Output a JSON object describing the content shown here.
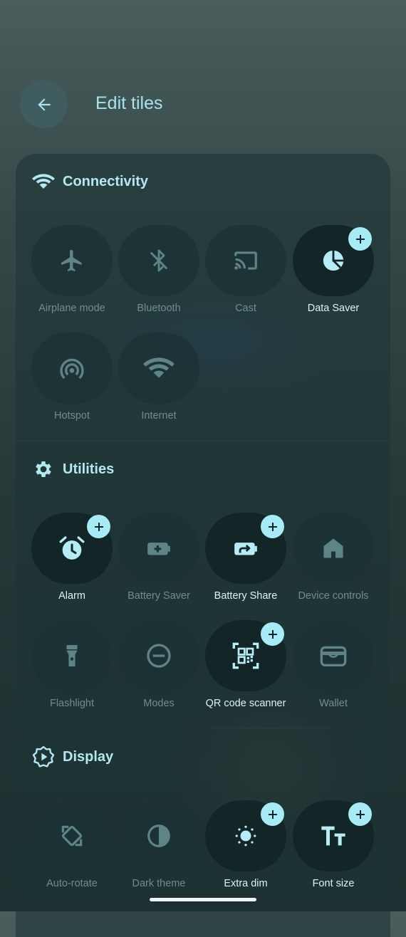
{
  "header": {
    "title": "Edit tiles"
  },
  "sections": [
    {
      "title": "Connectivity",
      "tiles": [
        {
          "label": "Airplane mode",
          "icon": "airplane-icon",
          "active": false
        },
        {
          "label": "Bluetooth",
          "icon": "bluetooth-off-icon",
          "active": false
        },
        {
          "label": "Cast",
          "icon": "cast-icon",
          "active": false
        },
        {
          "label": "Data Saver",
          "icon": "data-saver-icon",
          "active": true
        },
        {
          "label": "Hotspot",
          "icon": "hotspot-icon",
          "active": false
        },
        {
          "label": "Internet",
          "icon": "wifi-icon",
          "active": false
        }
      ]
    },
    {
      "title": "Utilities",
      "tiles": [
        {
          "label": "Alarm",
          "icon": "alarm-icon",
          "active": true
        },
        {
          "label": "Battery Saver",
          "icon": "battery-saver-icon",
          "active": false
        },
        {
          "label": "Battery Share",
          "icon": "battery-share-icon",
          "active": true
        },
        {
          "label": "Device controls",
          "icon": "home-icon",
          "active": false
        },
        {
          "label": "Flashlight",
          "icon": "flashlight-icon",
          "active": false
        },
        {
          "label": "Modes",
          "icon": "modes-icon",
          "active": false
        },
        {
          "label": "QR code scanner",
          "icon": "qr-scanner-icon",
          "active": true
        },
        {
          "label": "Wallet",
          "icon": "wallet-icon",
          "active": false
        }
      ]
    },
    {
      "title": "Display",
      "tiles": [
        {
          "label": "Auto-rotate",
          "icon": "auto-rotate-icon",
          "active": false
        },
        {
          "label": "Dark theme",
          "icon": "dark-theme-icon",
          "active": false
        },
        {
          "label": "Extra dim",
          "icon": "extra-dim-icon",
          "active": true
        },
        {
          "label": "Font size",
          "icon": "font-size-icon",
          "active": true
        }
      ]
    }
  ],
  "colors": {
    "accent": "#a6ebf5",
    "icon_inactive": "#5f8487",
    "icon_active": "#b6ecf5",
    "label_active": "#dcf2f4",
    "label_inactive": "#6f8d8f"
  }
}
